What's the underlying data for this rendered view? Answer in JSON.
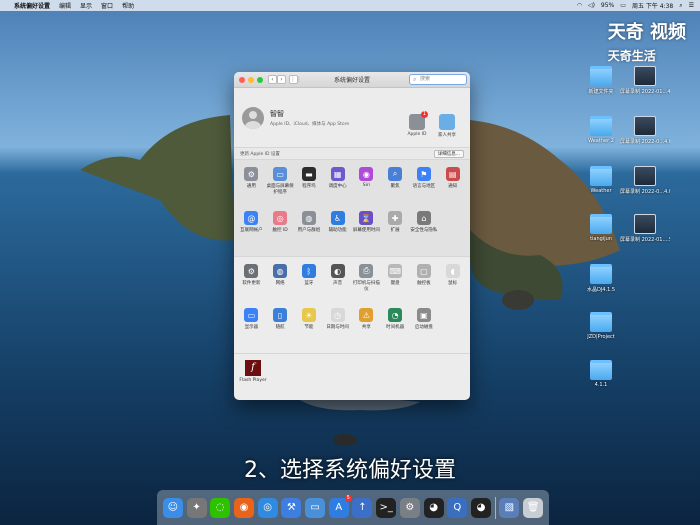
{
  "colors": {
    "accent": "#3b82f6"
  },
  "menubar": {
    "app": "系统偏好设置",
    "items": [
      "编辑",
      "显示",
      "窗口",
      "帮助"
    ],
    "battery": "95%",
    "clock": "周五 下午 4:38"
  },
  "watermark": {
    "line1": "天奇",
    "line2": "视频",
    "line3": "天奇生活"
  },
  "desktop_icons": [
    {
      "label": "新建文件夹",
      "kind": "folder"
    },
    {
      "label": "屏幕录制 2022-01...4.12.19",
      "kind": "shot"
    },
    {
      "label": "Weather 2",
      "kind": "folder"
    },
    {
      "label": "屏幕录制 2022-0...4.05.45",
      "kind": "shot"
    },
    {
      "label": "Weather",
      "kind": "folder"
    },
    {
      "label": "屏幕录制 2022-0...4.04.17",
      "kind": "shot"
    },
    {
      "label": "tiangijun",
      "kind": "folder"
    },
    {
      "label": "屏幕录制 2022-01....59.mov",
      "kind": "shot"
    },
    {
      "label": "水晶DJ4.1.5",
      "kind": "folder"
    },
    {
      "label": "JZD|Project",
      "kind": "folder"
    },
    {
      "label": "4.1.1",
      "kind": "folder"
    }
  ],
  "window": {
    "title": "系统偏好设置",
    "search_placeholder": "搜索",
    "account": {
      "name": "智智",
      "subtitle": "Apple ID、iCloud、媒体与 App Store",
      "apple_id_label": "Apple ID",
      "apple_id_badge": "1",
      "family_label": "家人共享"
    },
    "update": {
      "text": "更新 Apple ID 设置",
      "button": "详细信息..."
    },
    "section1": [
      {
        "label": "通用",
        "icon": "general-icon",
        "color": "#8a8f98",
        "glyph": "⚙"
      },
      {
        "label": "桌面与屏幕保护程序",
        "icon": "desktop-icon",
        "color": "#5a8fd8",
        "glyph": "▭"
      },
      {
        "label": "程序坞",
        "icon": "dock-icon",
        "color": "#2d2d2d",
        "glyph": "▬"
      },
      {
        "label": "调度中心",
        "icon": "mission-control-icon",
        "color": "#6a5acd",
        "glyph": "▦"
      },
      {
        "label": "Siri",
        "icon": "siri-icon",
        "color": "#b04ad8",
        "glyph": "◉"
      },
      {
        "label": "聚焦",
        "icon": "spotlight-icon",
        "color": "#4a7fd8",
        "glyph": "⌕"
      },
      {
        "label": "语言与地区",
        "icon": "language-icon",
        "color": "#3b82f6",
        "glyph": "⚑"
      },
      {
        "label": "通知",
        "icon": "notifications-icon",
        "color": "#c94b4b",
        "glyph": "▤"
      },
      {
        "label": "互联网帐户",
        "icon": "internet-accounts-icon",
        "color": "#3b82f6",
        "glyph": "@"
      },
      {
        "label": "触控 ID",
        "icon": "touch-id-icon",
        "color": "#e87a8a",
        "glyph": "◎"
      },
      {
        "label": "用户与群组",
        "icon": "users-icon",
        "color": "#8a8f98",
        "glyph": "◍"
      },
      {
        "label": "辅助功能",
        "icon": "accessibility-icon",
        "color": "#2f7de0",
        "glyph": "♿"
      },
      {
        "label": "屏幕使用时间",
        "icon": "screen-time-icon",
        "color": "#6a4fc8",
        "glyph": "⌛"
      },
      {
        "label": "扩展",
        "icon": "extensions-icon",
        "color": "#aaaaaa",
        "glyph": "✚"
      },
      {
        "label": "安全性与隐私",
        "icon": "security-icon",
        "color": "#7a7a7a",
        "glyph": "⌂"
      }
    ],
    "section2": [
      {
        "label": "软件更新",
        "icon": "software-update-icon",
        "color": "#6b6f76",
        "glyph": "⚙"
      },
      {
        "label": "网络",
        "icon": "network-icon",
        "color": "#4a6fa8",
        "glyph": "◍"
      },
      {
        "label": "蓝牙",
        "icon": "bluetooth-icon",
        "color": "#2f7de0",
        "glyph": "ᛒ"
      },
      {
        "label": "声音",
        "icon": "sound-icon",
        "color": "#555555",
        "glyph": "◐"
      },
      {
        "label": "打印机与扫描仪",
        "icon": "printer-icon",
        "color": "#8a8f98",
        "glyph": "⎙"
      },
      {
        "label": "键盘",
        "icon": "keyboard-icon",
        "color": "#b8b8b8",
        "glyph": "⌨"
      },
      {
        "label": "触控板",
        "icon": "trackpad-icon",
        "color": "#b0b0b0",
        "glyph": "▢"
      },
      {
        "label": "鼠标",
        "icon": "mouse-icon",
        "color": "#d8d8d8",
        "glyph": "◖"
      },
      {
        "label": "显示器",
        "icon": "displays-icon",
        "color": "#3b82f6",
        "glyph": "▭"
      },
      {
        "label": "随航",
        "icon": "sidecar-icon",
        "color": "#3b7fd8",
        "glyph": "▯"
      },
      {
        "label": "节能",
        "icon": "energy-saver-icon",
        "color": "#e8c84a",
        "glyph": "☀"
      },
      {
        "label": "日期与时间",
        "icon": "date-time-icon",
        "color": "#d8d8d8",
        "glyph": "◷"
      },
      {
        "label": "共享",
        "icon": "sharing-icon",
        "color": "#e0a030",
        "glyph": "⚠"
      },
      {
        "label": "时间机器",
        "icon": "time-machine-icon",
        "color": "#2a8a5a",
        "glyph": "◔"
      },
      {
        "label": "启动磁盘",
        "icon": "startup-disk-icon",
        "color": "#8a8a8a",
        "glyph": "▣"
      }
    ],
    "other": [
      {
        "label": "Flash Player",
        "icon": "flash-player-icon"
      }
    ]
  },
  "subtitle": "2、选择系统偏好设置",
  "dock": [
    {
      "name": "finder-icon",
      "color": "#3b8ee8",
      "glyph": "☺"
    },
    {
      "name": "launchpad-icon",
      "color": "#777777",
      "glyph": "✦"
    },
    {
      "name": "wechat-icon",
      "color": "#2dc100",
      "glyph": "◌"
    },
    {
      "name": "firefox-icon",
      "color": "#e8641a",
      "glyph": "◉"
    },
    {
      "name": "safari-icon",
      "color": "#2f8ae0",
      "glyph": "◎"
    },
    {
      "name": "xcode-icon",
      "color": "#3d7ee0",
      "glyph": "⚒"
    },
    {
      "name": "files-icon",
      "color": "#4a90d8",
      "glyph": "▭"
    },
    {
      "name": "app-store-icon",
      "color": "#2f7de0",
      "glyph": "A",
      "badge": "5"
    },
    {
      "name": "upload-icon",
      "color": "#3b6fc8",
      "glyph": "↑"
    },
    {
      "name": "terminal-icon",
      "color": "#222222",
      "glyph": ">_"
    },
    {
      "name": "system-preferences-icon",
      "color": "#7a7f86",
      "glyph": "⚙"
    },
    {
      "name": "qq-icon",
      "color": "#222222",
      "glyph": "◕"
    },
    {
      "name": "quicktime-icon",
      "color": "#3a6fc0",
      "glyph": "Q"
    },
    {
      "name": "qq-alt-icon",
      "color": "#222222",
      "glyph": "◕"
    },
    {
      "name": "preview-icon",
      "color": "#5a7fb8",
      "glyph": "▧"
    },
    {
      "name": "trash-icon",
      "color": "#c8cdd4",
      "glyph": "🗑"
    }
  ]
}
